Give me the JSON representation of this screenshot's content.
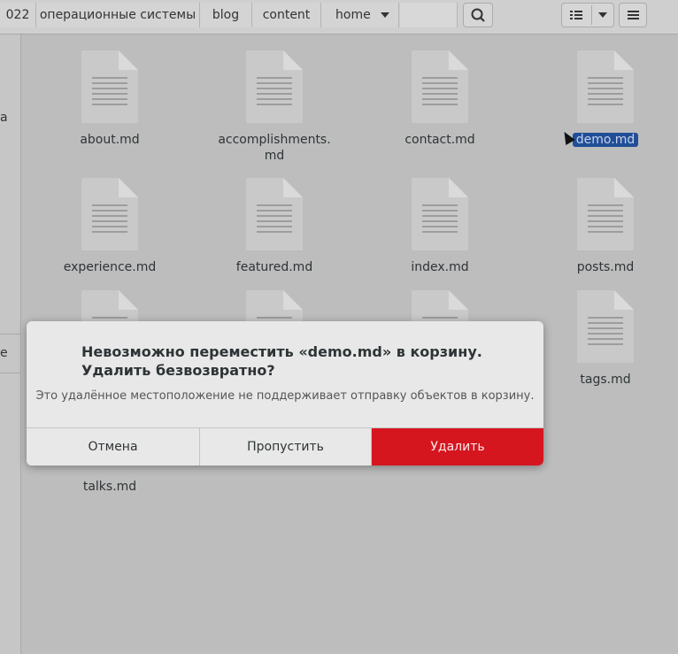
{
  "header": {
    "crumbs": [
      "022",
      "операционные системы",
      "blog",
      "content",
      "home"
    ],
    "search_icon": "search-icon",
    "view_icon": "list-view-icon",
    "menu_icon": "hamburger-menu-icon"
  },
  "sidebar": {
    "char_a": "a",
    "char_e": "e"
  },
  "files": [
    {
      "name": "about.md"
    },
    {
      "name": "accomplishments.\nmd"
    },
    {
      "name": "contact.md"
    },
    {
      "name": "demo.md"
    },
    {
      "name": "experience.md"
    },
    {
      "name": "featured.md"
    },
    {
      "name": "index.md"
    },
    {
      "name": "posts.md"
    },
    {
      "name": "tags.md"
    },
    {
      "name": "talks.md"
    }
  ],
  "dialog": {
    "title": "Невозможно переместить «demo.md» в корзину. Удалить безвозвратно?",
    "message": "Это удалённое местоположение не поддерживает отправку объектов в корзину.",
    "cancel_label": "Отмена",
    "skip_label": "Пропустить",
    "delete_label": "Удалить"
  },
  "colors": {
    "delete_button": "#d5161f",
    "selection": "#214e98"
  }
}
